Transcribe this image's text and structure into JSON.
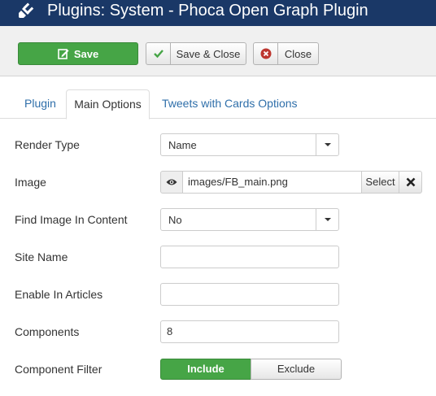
{
  "header": {
    "title": "Plugins: System - Phoca Open Graph Plugin",
    "icon": "plug-icon",
    "bg_color": "#1a3867"
  },
  "toolbar": {
    "save_label": "Save",
    "save_close_label": "Save & Close",
    "close_label": "Close",
    "save_color": "#46a546"
  },
  "tabs": [
    {
      "label": "Plugin",
      "active": false
    },
    {
      "label": "Main Options",
      "active": true
    },
    {
      "label": "Tweets with Cards Options",
      "active": false
    }
  ],
  "form": {
    "render_type": {
      "label": "Render Type",
      "value": "Name"
    },
    "image": {
      "label": "Image",
      "value": "images/FB_main.png",
      "select_label": "Select"
    },
    "find_image": {
      "label": "Find Image In Content",
      "value": "No"
    },
    "site_name": {
      "label": "Site Name",
      "value": ""
    },
    "enable_in_articles": {
      "label": "Enable In Articles",
      "value": ""
    },
    "components": {
      "label": "Components",
      "value": "8"
    },
    "component_filter": {
      "label": "Component Filter",
      "options": [
        "Include",
        "Exclude"
      ],
      "selected": "Include"
    }
  }
}
